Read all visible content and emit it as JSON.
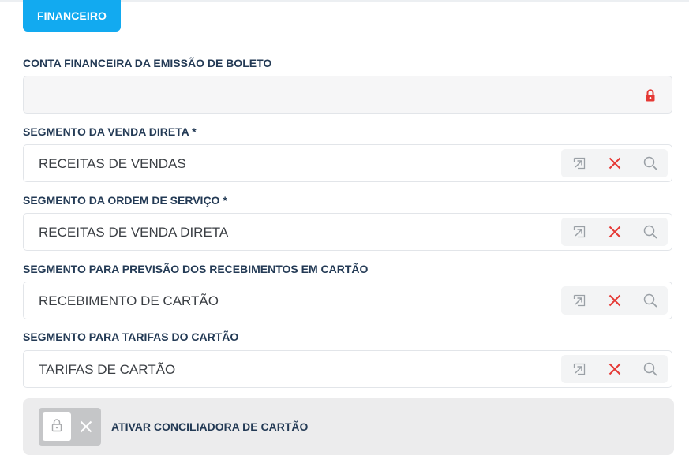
{
  "tab": {
    "label": "FINANCEIRO"
  },
  "fields": {
    "conta_financeira": {
      "label": "CONTA FINANCEIRA DA EMISSÃO DE BOLETO",
      "value": ""
    },
    "segmento_venda_direta": {
      "label": "SEGMENTO DA VENDA DIRETA *",
      "value": "RECEITAS DE VENDAS"
    },
    "segmento_ordem_servico": {
      "label": "SEGMENTO DA ORDEM DE SERVIÇO *",
      "value": "RECEITAS DE VENDA DIRETA"
    },
    "segmento_previsao_cartao": {
      "label": "SEGMENTO PARA PREVISÃO DOS RECEBIMENTOS EM CARTÃO",
      "value": "RECEBIMENTO DE CARTÃO"
    },
    "segmento_tarifas_cartao": {
      "label": "SEGMENTO PARA TARIFAS DO CARTÃO",
      "value": "TARIFAS DE CARTÃO"
    }
  },
  "toggle": {
    "label": "ATIVAR CONCILIADORA DE CARTÃO",
    "enabled": false
  },
  "icons": {
    "lock": "lock-icon",
    "open": "open-external-icon",
    "clear": "close-icon",
    "search": "search-icon"
  },
  "colors": {
    "tab": "#12aaf0",
    "label": "#233a55",
    "clear": "#e53935",
    "lock": "#e53935"
  }
}
